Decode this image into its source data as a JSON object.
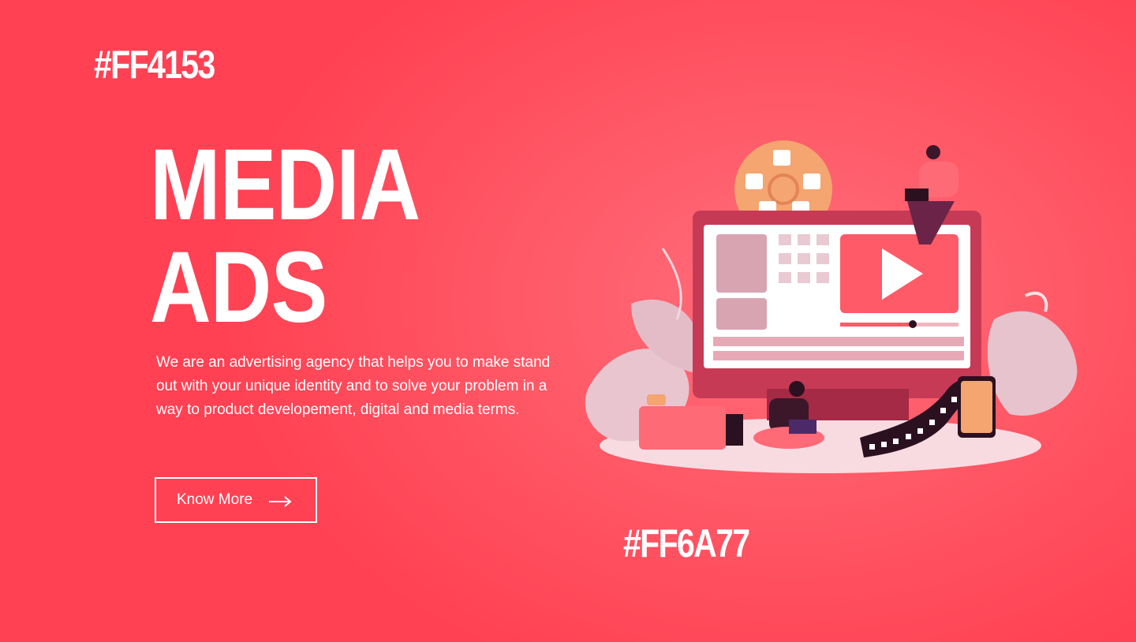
{
  "hex_top": "#FF4153",
  "hex_bottom": "#FF6A77",
  "headline": {
    "line1": "MEDIA",
    "line2": "ADS"
  },
  "description": "We are an advertising agency that helps you to make stand out with your unique identity and  to solve your problem in a way to product developement, digital and media terms.",
  "cta": {
    "label": "Know More",
    "icon": "arrow-right-icon"
  },
  "colors": {
    "primary": "#FF4153",
    "secondary": "#FF6A77"
  }
}
